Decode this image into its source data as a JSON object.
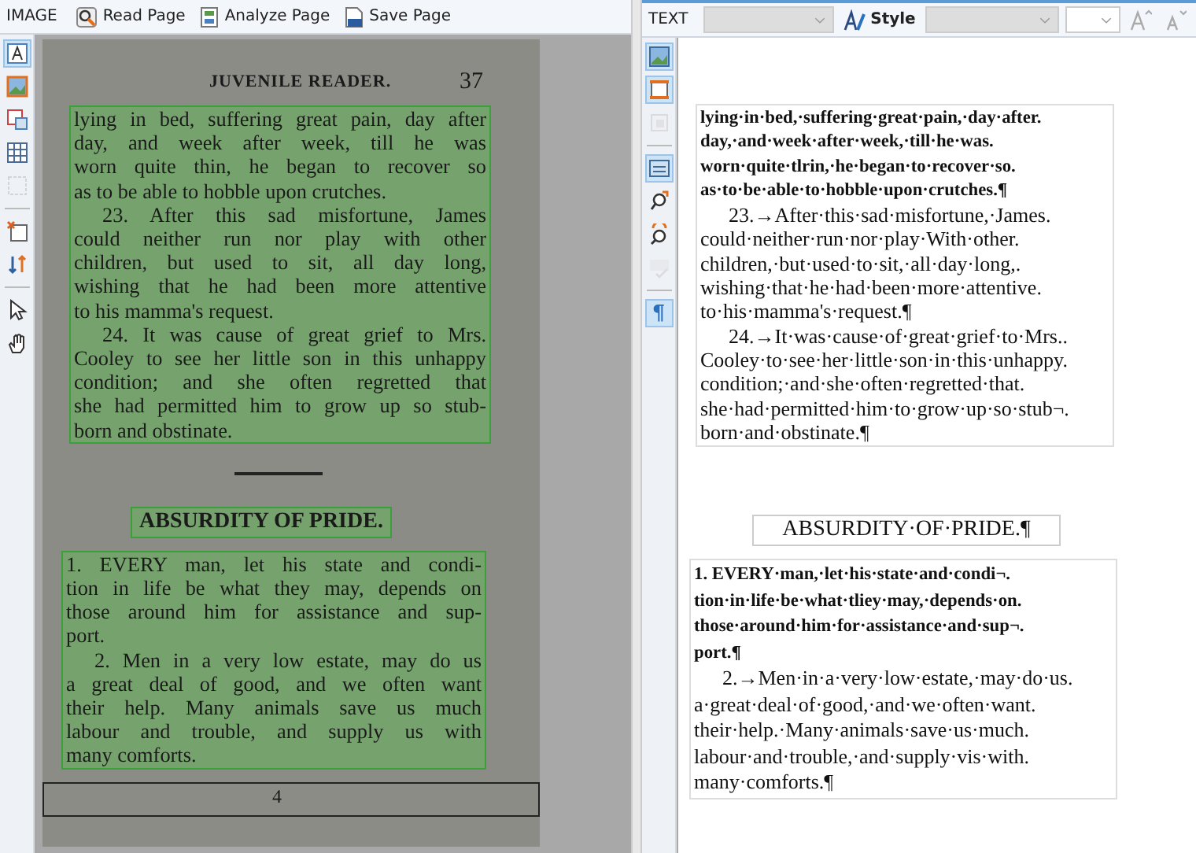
{
  "image_panel": {
    "title": "IMAGE",
    "buttons": [
      {
        "label": "Read Page"
      },
      {
        "label": "Analyze Page"
      },
      {
        "label": "Save Page"
      }
    ],
    "tools": [
      {
        "selected": true,
        "disabled": false
      },
      {
        "selected": false,
        "disabled": false
      },
      {
        "selected": false,
        "disabled": false
      },
      {
        "selected": false,
        "disabled": false
      },
      {
        "selected": false,
        "disabled": true
      },
      {
        "selected": false,
        "disabled": false
      },
      {
        "selected": false,
        "disabled": false
      },
      {
        "selected": false,
        "disabled": false
      },
      {
        "selected": false,
        "disabled": false
      }
    ],
    "scan": {
      "running_head": "JUVENILE READER.",
      "page_number": "37",
      "footer": "4",
      "blocks": [
        {
          "kind": "text",
          "paragraphs": [
            {
              "lines": [
                "lying in bed, suffering great pain, day after",
                "day, and week after week, till he was",
                "worn quite thin, he began to recover so",
                "as to be able to hobble upon crutches."
              ]
            },
            {
              "lines": [
                "23. After this sad misfortune, James",
                "could neither run nor play with other",
                "children, but used to sit, all day long,",
                "wishing that he had been more attentive",
                "to his mamma's request."
              ]
            },
            {
              "lines": [
                "24. It was cause of great grief to Mrs.",
                "Cooley to see her little son in this unhappy",
                "condition; and she often regretted that",
                "she had permitted him to grow up so stub-",
                "born and obstinate."
              ]
            }
          ]
        },
        {
          "kind": "title",
          "text": "ABSURDITY OF PRIDE."
        },
        {
          "kind": "text",
          "paragraphs": [
            {
              "lines": [
                "1. EVERY man, let his state and condi-",
                "tion in life be what they may, depends on",
                "those around him for assistance and sup-",
                "port."
              ]
            },
            {
              "lines": [
                "2. Men in a very low estate, may do us",
                "a great deal of good, and we often want",
                "their help.  Many animals save us much",
                "labour and trouble, and supply us with",
                "many comforts."
              ]
            }
          ]
        }
      ]
    }
  },
  "text_panel": {
    "title": "TEXT",
    "style_button": "Style",
    "tools": [
      {
        "selected": true,
        "disabled": false
      },
      {
        "selected": true,
        "disabled": false
      },
      {
        "selected": false,
        "disabled": true
      },
      {
        "selected": true,
        "disabled": false
      },
      {
        "selected": false,
        "disabled": false
      },
      {
        "selected": false,
        "disabled": false
      },
      {
        "selected": false,
        "disabled": true
      },
      {
        "selected": true,
        "disabled": false,
        "label": "¶"
      }
    ],
    "blocks": [
      {
        "kind": "text",
        "paragraphs": [
          {
            "bold": true,
            "lines": [
              "lying·in·bed,·suffering·great·pain,·day·after.",
              "day,·and·week·after·week,·till·he·was.",
              "worn·quite·tlrin,·he·began·to·recover·so.",
              "as·to·be·able·to·hobble·upon·crutches.¶"
            ]
          },
          {
            "bold": false,
            "lines": [
              "23.→After·this·sad·misfortune,·James.",
              "could·neither·run·nor·play·With·other.",
              "children,·but·used·to·sit,·all·day·long,.",
              "wishing·that·he·had·been·more·attentive.",
              "to·his·mamma's·request.¶"
            ]
          },
          {
            "bold": false,
            "lines": [
              "24.→It·was·cause·of·great·grief·to·Mrs..",
              "Cooley·to·see·her·little·son·in·this·unhappy.",
              "condition;·and·she·often·regretted·that.",
              "she·had·permitted·him·to·grow·up·so·stub¬.",
              "born·and·obstinate.¶"
            ]
          }
        ]
      },
      {
        "kind": "title",
        "text": "ABSURDITY·OF·PRIDE.¶"
      },
      {
        "kind": "text",
        "paragraphs": [
          {
            "bold": true,
            "lines": [
              "1. EVERY·man,·let·his·state·and·condi¬.",
              "tion·in·life·be·what·tliey·may,·depends·on.",
              "those·around·him·for·assistance·and·sup¬.",
              "port.¶"
            ]
          },
          {
            "bold": false,
            "lines": [
              "2.→Men·in·a·very·low·estate,·may·do·us.",
              "a·great·deal·of·good,·and·we·often·want.",
              "their·help.·Many·animals·save·us·much.",
              "labour·and·trouble,·and·supply·vis·with.",
              "many·comforts.¶"
            ]
          }
        ]
      }
    ]
  }
}
